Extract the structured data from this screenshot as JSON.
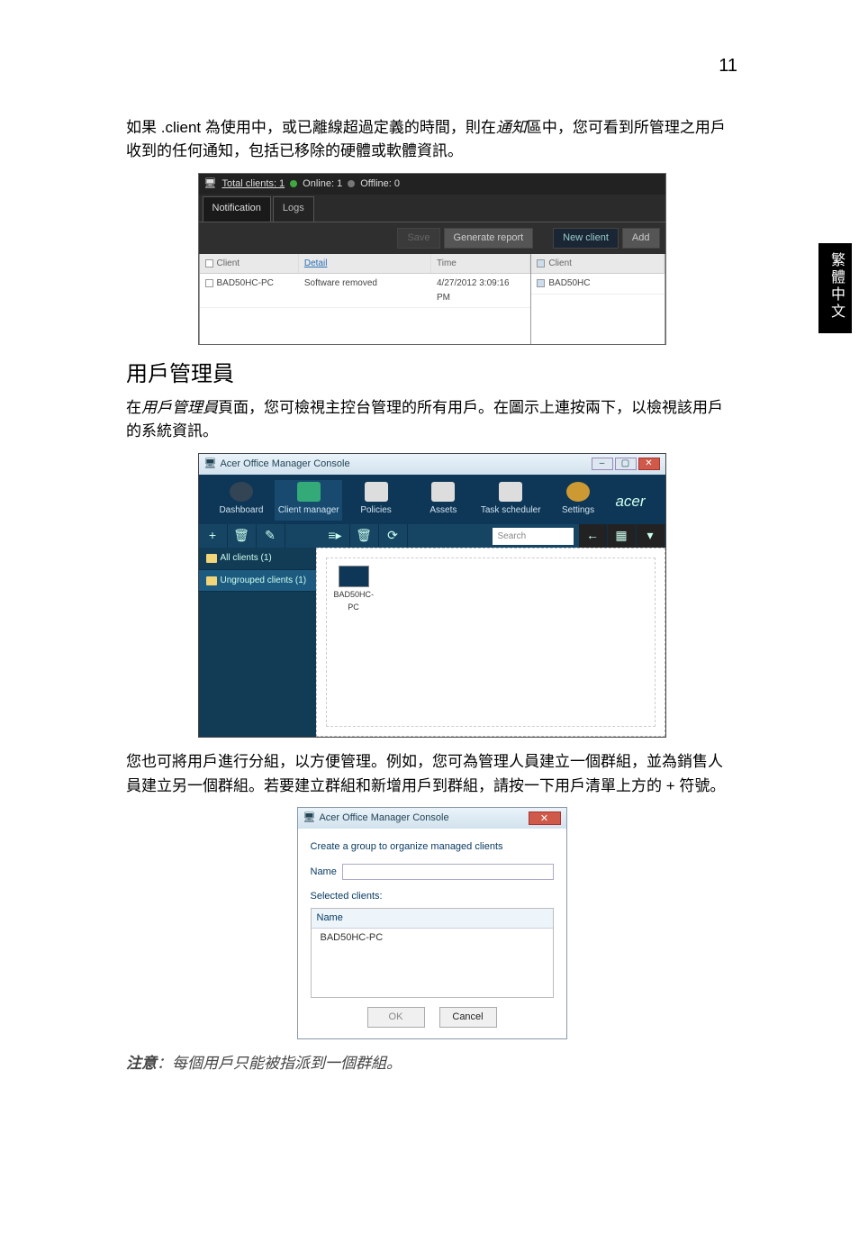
{
  "page_number": "11",
  "side_tab": "繁體中文",
  "para1_pre": "如果 .client 為使用中，或已離線超過定義的時間，則在",
  "para1_em": "通知",
  "para1_post": "區中，您可看到所管理之用戶收到的任何通知，包括已移除的硬體或軟體資訊。",
  "h2_client_manager": "用戶管理員",
  "para2_pre": "在",
  "para2_em": "用戶管理員",
  "para2_post": "頁面，您可檢視主控台管理的所有用戶。在圖示上連按兩下，以檢視該用戶的系統資訊。",
  "para3": "您也可將用戶進行分組，以方便管理。例如，您可為管理人員建立一個群組，並為銷售人員建立另一個群組。若要建立群組和新增用戶到群組，請按一下用戶清單上方的 + 符號。",
  "note_lead": "注意",
  "note_body": "：每個用戶只能被指派到一個群組。",
  "ss1": {
    "total_clients": "Total clients: 1",
    "online": "Online: 1",
    "offline": "Offline: 0",
    "tab_notification": "Notification",
    "tab_logs": "Logs",
    "btn_save": "Save",
    "btn_generate": "Generate report",
    "btn_newclient": "New client",
    "btn_add": "Add",
    "col_client": "Client",
    "col_detail": "Detail",
    "col_time": "Time",
    "col_client2": "Client",
    "row1_client": "BAD50HC-PC",
    "row1_detail": "Software removed",
    "row1_time": "4/27/2012 3:09:16 PM",
    "side_item": "BAD50HC"
  },
  "ss2": {
    "title": "Acer Office Manager Console",
    "nav": [
      "Dashboard",
      "Client manager",
      "Policies",
      "Assets",
      "Task scheduler",
      "Settings"
    ],
    "logo": "acer",
    "search_placeholder": "Search",
    "sidebar_all": "All clients (1)",
    "sidebar_ungrouped": "Ungrouped clients (1)",
    "client_name": "BAD50HC-PC"
  },
  "ss3": {
    "title": "Acer Office Manager Console",
    "heading": "Create a group to organize managed clients",
    "name_label": "Name",
    "selected_label": "Selected clients:",
    "col_name": "Name",
    "row1": "BAD50HC-PC",
    "btn_ok": "OK",
    "btn_cancel": "Cancel"
  }
}
